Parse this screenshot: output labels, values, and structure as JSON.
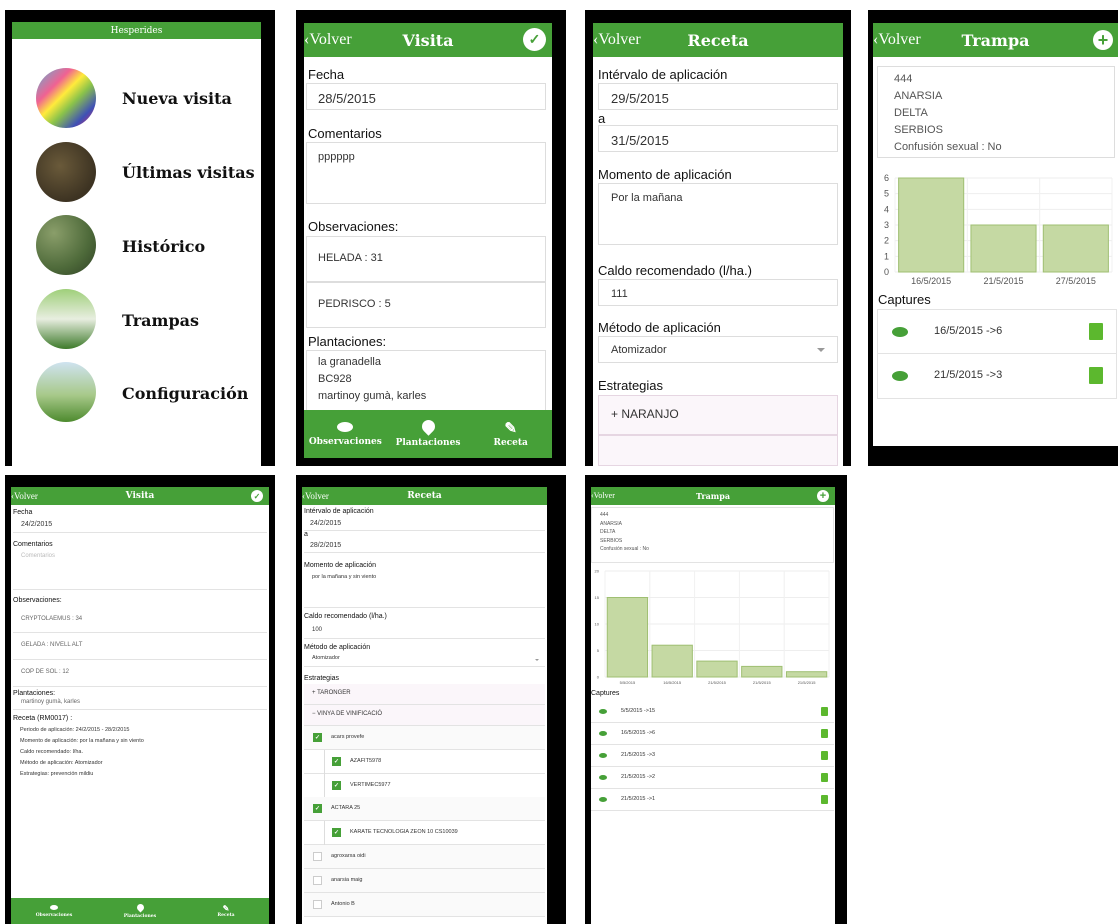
{
  "menu": {
    "title": "Hesperides",
    "items": [
      "Nueva visita",
      "Últimas visitas",
      "Histórico",
      "Trampas",
      "Configuración"
    ]
  },
  "visita1": {
    "back": "Volver",
    "title": "Visita",
    "fecha_label": "Fecha",
    "fecha": "28/5/2015",
    "coment_label": "Comentarios",
    "coment": "pppppp",
    "obs_label": "Observaciones:",
    "obs": [
      "HELADA : 31",
      "PEDRISCO : 5"
    ],
    "plant_label": "Plantaciones:",
    "plants": [
      "la granadella",
      "BC928",
      "martinoy gumà, karles"
    ],
    "footer": [
      "Observaciones",
      "Plantaciones",
      "Receta"
    ]
  },
  "receta1": {
    "back": "Volver",
    "title": "Receta",
    "interval_label": "Intérvalo de aplicación",
    "from": "29/5/2015",
    "a": "a",
    "to": "31/5/2015",
    "momento_label": "Momento de aplicación",
    "momento": "Por la mañana",
    "caldo_label": "Caldo recomendado (l/ha.)",
    "caldo": "111",
    "metodo_label": "Método de aplicación",
    "metodo": "Atomizador",
    "estrat_label": "Estrategias",
    "estrat": "+ NARANJO"
  },
  "trampa1": {
    "back": "Volver",
    "title": "Trampa",
    "info": [
      "444",
      "ANARSIA",
      "DELTA",
      "SERBIOS",
      "Confusión sexual : No"
    ],
    "captures_label": "Captures",
    "captures": [
      "16/5/2015 ->6",
      "21/5/2015 ->3"
    ]
  },
  "visita2": {
    "back": "Volver",
    "title": "Visita",
    "fecha_label": "Fecha",
    "fecha": "24/2/2015",
    "coment_label": "Comentarios",
    "coment_ph": "Comentarios",
    "obs_label": "Observaciones:",
    "obs": [
      "CRYPTOLAEMUS : 34",
      "GELADA : NIVELL ALT",
      "COP DE SOL : 12"
    ],
    "plant_label": "Plantaciones:",
    "plant": "martinoy gumà, karles",
    "receta_title": "Receta (RM0017) :",
    "receta_lines": [
      "Periodo de aplicación: 24/2/2015 - 28/2/2015",
      "Momento de aplicación: por la mañana y sin viento",
      "Caldo recomendado: l/ha.",
      "Método de aplicación: Atomizador",
      "Estrategias: prevención mildiu"
    ],
    "footer": [
      "Observaciones",
      "Plantaciones",
      "Receta"
    ]
  },
  "receta2": {
    "back": "Volver",
    "title": "Receta",
    "interval_label": "Intérvalo de aplicación",
    "from": "24/2/2015",
    "a": "a",
    "to": "28/2/2015",
    "momento_label": "Momento de aplicación",
    "momento": "por la mañana y sin viento",
    "caldo_label": "Caldo recomendado (l/ha.)",
    "caldo": "100",
    "metodo_label": "Método de aplicación",
    "metodo": "Atomizador",
    "estrat_label": "Estrategias",
    "groups": [
      "+ TARONGER",
      "− VINYA DE VINIFICACIÓ"
    ],
    "items": [
      {
        "t": "acars provefe",
        "c": true,
        "ind": 0
      },
      {
        "t": "AZAFIT5978",
        "c": true,
        "ind": 1
      },
      {
        "t": "VERTIMEC5977",
        "c": true,
        "ind": 1
      },
      {
        "t": "ACTARA 25",
        "c": true,
        "ind": 0
      },
      {
        "t": "KARATE TECNOLOGIA ZEON 10 CS10039",
        "c": true,
        "ind": 1
      },
      {
        "t": "agroxarxa oidi",
        "c": false,
        "ind": 0
      },
      {
        "t": "anarsia maig",
        "c": false,
        "ind": 0
      },
      {
        "t": "Antonio B",
        "c": false,
        "ind": 0
      }
    ]
  },
  "trampa2": {
    "back": "Volver",
    "title": "Trampa",
    "info": [
      "444",
      "ANARSIA",
      "DELTA",
      "SERBIOS",
      "Confusión sexual : No"
    ],
    "captures_label": "Captures",
    "captures": [
      "5/5/2015 ->15",
      "16/5/2015 ->6",
      "21/5/2015 ->3",
      "21/5/2015 ->2",
      "21/5/2015 ->1"
    ]
  },
  "colors": {
    "green": "#46a038",
    "bar": "#c5d9a3",
    "trash": "#5cb82e"
  },
  "chart_data": [
    {
      "type": "bar",
      "categories": [
        "16/5/2015",
        "21/5/2015",
        "27/5/2015"
      ],
      "values": [
        6,
        3,
        3
      ],
      "ylim": [
        0,
        6
      ],
      "yticks": [
        0,
        1,
        2,
        3,
        4,
        5,
        6
      ]
    },
    {
      "type": "bar",
      "categories": [
        "5/5/2015",
        "16/5/2015",
        "21/5/2015",
        "21/5/2015",
        "21/5/2015"
      ],
      "values": [
        15,
        6,
        3,
        2,
        1
      ],
      "ylim": [
        0,
        20
      ],
      "yticks": [
        0,
        5,
        10,
        15,
        20
      ]
    }
  ]
}
